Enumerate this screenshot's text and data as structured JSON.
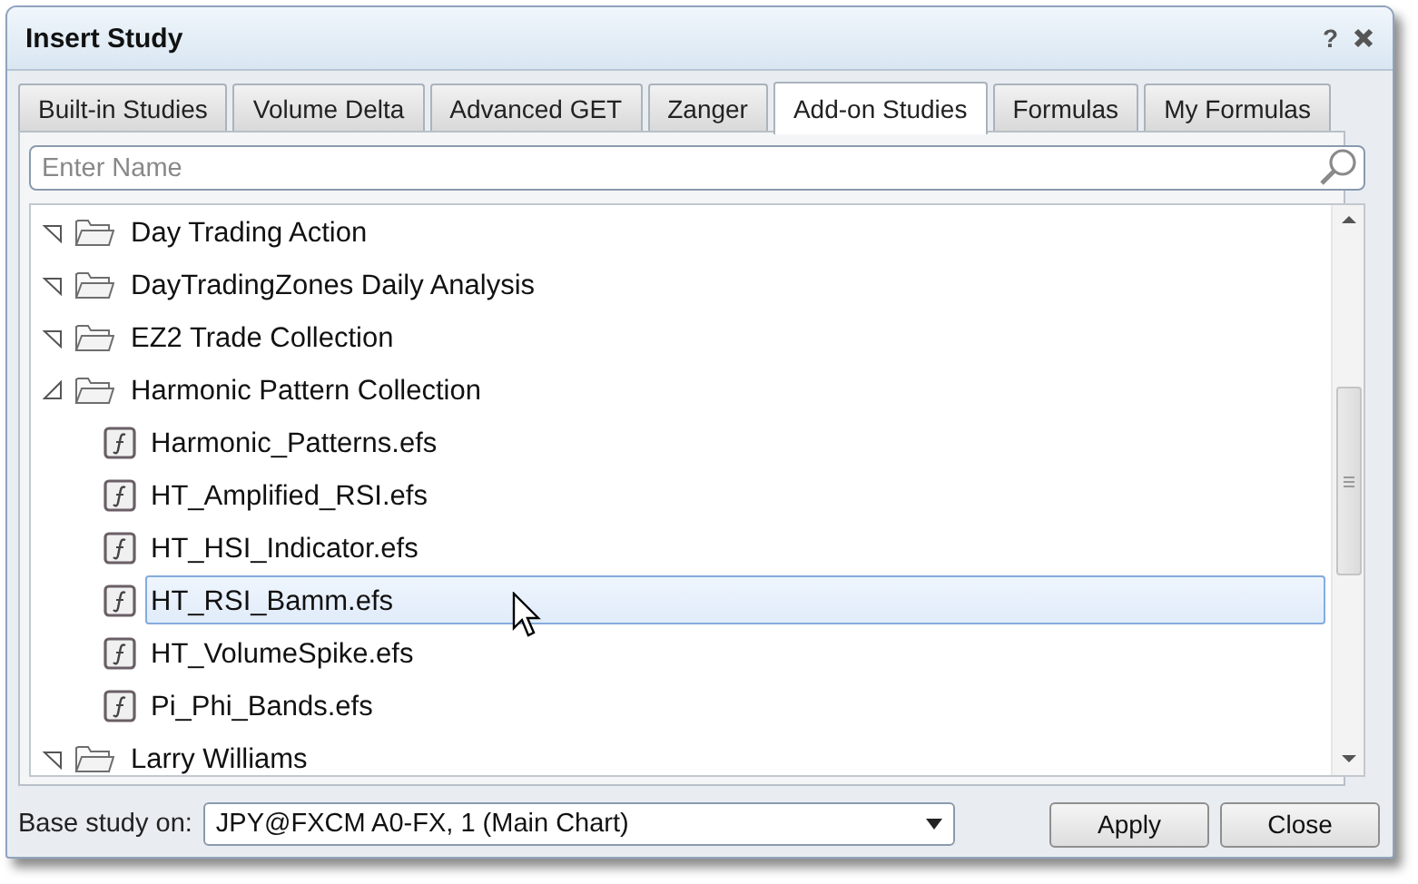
{
  "window": {
    "title": "Insert Study",
    "help": "?"
  },
  "tabs": [
    {
      "label": "Built-in Studies",
      "selected": false
    },
    {
      "label": "Volume Delta",
      "selected": false
    },
    {
      "label": "Advanced GET",
      "selected": false
    },
    {
      "label": "Zanger",
      "selected": false
    },
    {
      "label": "Add-on Studies",
      "selected": true
    },
    {
      "label": "Formulas",
      "selected": false
    },
    {
      "label": "My Formulas",
      "selected": false
    }
  ],
  "search": {
    "placeholder": "Enter Name"
  },
  "tree": [
    {
      "kind": "folder",
      "label": "Day Trading Action",
      "expanded": false
    },
    {
      "kind": "folder",
      "label": "DayTradingZones Daily Analysis",
      "expanded": false
    },
    {
      "kind": "folder",
      "label": "EZ2 Trade Collection",
      "expanded": false
    },
    {
      "kind": "folder",
      "label": "Harmonic Pattern Collection",
      "expanded": true,
      "children": [
        {
          "kind": "file",
          "label": "Harmonic_Patterns.efs",
          "selected": false
        },
        {
          "kind": "file",
          "label": "HT_Amplified_RSI.efs",
          "selected": false
        },
        {
          "kind": "file",
          "label": "HT_HSI_Indicator.efs",
          "selected": false
        },
        {
          "kind": "file",
          "label": "HT_RSI_Bamm.efs",
          "selected": true
        },
        {
          "kind": "file",
          "label": "HT_VolumeSpike.efs",
          "selected": false
        },
        {
          "kind": "file",
          "label": "Pi_Phi_Bands.efs",
          "selected": false
        }
      ]
    },
    {
      "kind": "folder",
      "label": "Larry Williams",
      "expanded": false
    }
  ],
  "base_study": {
    "label": "Base study on:",
    "value": "JPY@FXCM A0-FX, 1 (Main Chart)"
  },
  "buttons": [
    "Apply",
    "Close"
  ]
}
